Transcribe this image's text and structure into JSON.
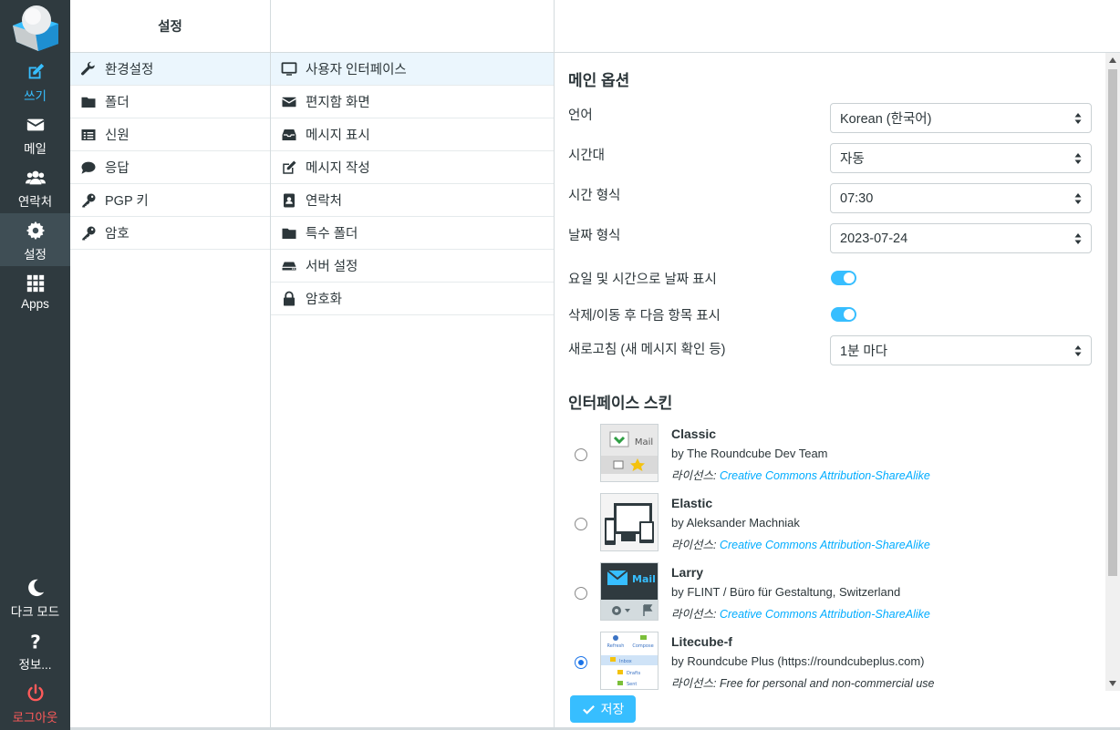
{
  "nav": {
    "compose": "쓰기",
    "mail": "메일",
    "contacts": "연락처",
    "settings": "설정",
    "apps": "Apps",
    "dark_mode": "다크 모드",
    "about": "정보...",
    "logout": "로그아웃"
  },
  "col1": {
    "header": "설정",
    "items": [
      {
        "label": "환경설정",
        "icon": "wrench-icon"
      },
      {
        "label": "폴더",
        "icon": "folder-icon"
      },
      {
        "label": "신원",
        "icon": "id-card-icon"
      },
      {
        "label": "응답",
        "icon": "comment-icon"
      },
      {
        "label": "PGP 키",
        "icon": "key-icon"
      },
      {
        "label": "암호",
        "icon": "key-icon"
      }
    ]
  },
  "col2": {
    "items": [
      {
        "label": "사용자 인터페이스",
        "icon": "monitor-icon"
      },
      {
        "label": "편지함 화면",
        "icon": "envelope-icon"
      },
      {
        "label": "메시지 표시",
        "icon": "inbox-icon"
      },
      {
        "label": "메시지 작성",
        "icon": "compose-icon"
      },
      {
        "label": "연락처",
        "icon": "address-book-icon"
      },
      {
        "label": "특수 폴더",
        "icon": "folder-icon"
      },
      {
        "label": "서버 설정",
        "icon": "server-icon"
      },
      {
        "label": "암호화",
        "icon": "lock-icon"
      }
    ]
  },
  "main": {
    "section_main": "메인 옵션",
    "language_label": "언어",
    "language_value": "Korean (한국어)",
    "timezone_label": "시간대",
    "timezone_value": "자동",
    "time_format_label": "시간 형식",
    "time_format_value": "07:30",
    "date_format_label": "날짜 형식",
    "date_format_value": "2023-07-24",
    "pretty_date_label": "요일 및 시간으로 날짜 표시",
    "next_item_label": "삭제/이동 후 다음 항목 표시",
    "refresh_label": "새로고침 (새 메시지 확인 등)",
    "refresh_value": "1분 마다",
    "section_skin": "인터페이스 스킨",
    "license_prefix": "라이선스:",
    "skins": [
      {
        "name": "Classic",
        "author": "by The Roundcube Dev Team",
        "license": "Creative Commons Attribution-ShareAlike"
      },
      {
        "name": "Elastic",
        "author": "by Aleksander Machniak",
        "license": "Creative Commons Attribution-ShareAlike"
      },
      {
        "name": "Larry",
        "author": "by FLINT / Büro für Gestaltung, Switzerland",
        "license": "Creative Commons Attribution-ShareAlike"
      },
      {
        "name": "Litecube-f",
        "author": "by Roundcube Plus (https://roundcubeplus.com)",
        "license": "Free for personal and non-commercial use"
      }
    ],
    "thumb_text": {
      "classic_mail": "Mail",
      "larry_mail": "Mail",
      "lite_refresh": "Refresh",
      "lite_compose": "Compose",
      "lite_inbox": "Inbox",
      "lite_drafts": "Drafts",
      "lite_sent": "Sent"
    },
    "selected_skin": "Litecube-f",
    "save_label": "저장"
  },
  "colors": {
    "nav_bg": "#2f3a3f",
    "accent": "#37beff",
    "logout": "#ff5a5a",
    "selected_row": "#ebf6fd"
  }
}
